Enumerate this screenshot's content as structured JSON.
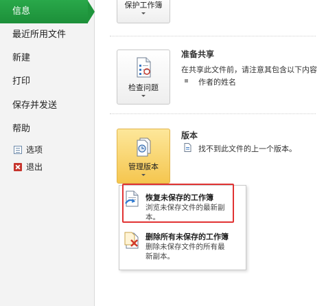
{
  "sidebar": {
    "items": [
      {
        "label": "信息",
        "active": true
      },
      {
        "label": "最近所用文件"
      },
      {
        "label": "新建"
      },
      {
        "label": "打印"
      },
      {
        "label": "保存并发送"
      },
      {
        "label": "帮助"
      }
    ],
    "options": {
      "label": "选项",
      "icon": "options-icon"
    },
    "exit": {
      "label": "退出",
      "icon": "exit-icon"
    }
  },
  "protect": {
    "button_label": "保护工作簿"
  },
  "prepare": {
    "button_label": "检查问题",
    "title": "准备共享",
    "description": "在共享此文件前，请注意其包含以下内容",
    "bullet": "作者的姓名"
  },
  "versions": {
    "button_label": "管理版本",
    "title": "版本",
    "note": "找不到此文件的上一个版本。"
  },
  "menu": {
    "recover": {
      "title": "恢复未保存的工作簿",
      "desc_line1": "浏览未保存文件的最新副",
      "desc_line2": "本。"
    },
    "delete": {
      "title": "删除所有未保存的工作簿",
      "desc_line1": "删除未保存文件的所有最",
      "desc_line2": "新副本。"
    }
  },
  "colors": {
    "accent_green": "#1f953c",
    "highlight_red": "#e13232",
    "manage_button": "#f5c64f"
  }
}
